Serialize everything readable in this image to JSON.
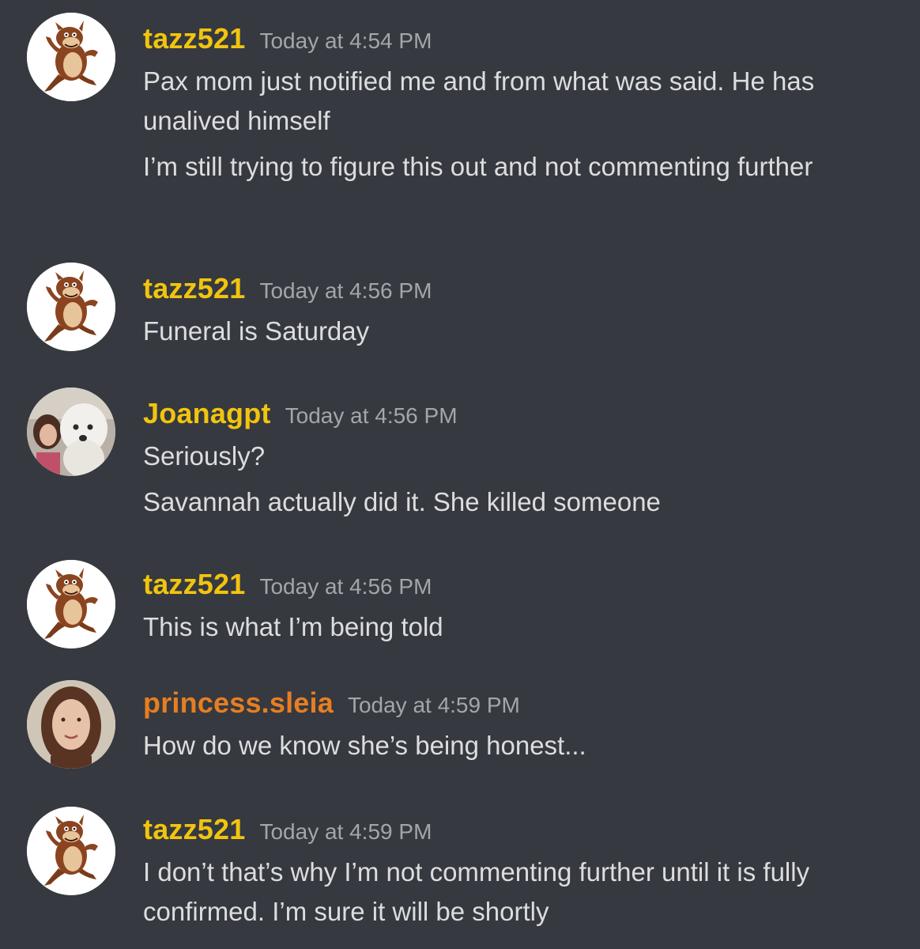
{
  "colors": {
    "background": "#36393f",
    "text": "#dcddde",
    "timestamp": "#a3a6aa",
    "username_yellow": "#f1c40f",
    "username_orange": "#e67e22"
  },
  "messages": [
    {
      "username": "tazz521",
      "timestamp": "Today at 4:54 PM",
      "avatar": "tasmanian-devil-avatar",
      "lines": [
        "Pax mom just notified me and from what was said. He has unalived himself",
        "I’m still trying to figure this out and not commenting further"
      ]
    },
    {
      "username": "tazz521",
      "timestamp": "Today at 4:56 PM",
      "avatar": "tasmanian-devil-avatar",
      "lines": [
        "Funeral is Saturday"
      ]
    },
    {
      "username": "Joanagpt",
      "timestamp": "Today at 4:56 PM",
      "avatar": "woman-with-dog-avatar",
      "lines": [
        "Seriously?",
        "Savannah actually did it. She killed someone"
      ]
    },
    {
      "username": "tazz521",
      "timestamp": "Today at 4:56 PM",
      "avatar": "tasmanian-devil-avatar",
      "lines": [
        "This is what I’m being told"
      ]
    },
    {
      "username": "princess.sleia",
      "timestamp": "Today at 4:59 PM",
      "avatar": "woman-portrait-avatar",
      "lines": [
        "How do we know she’s being honest..."
      ]
    },
    {
      "username": "tazz521",
      "timestamp": "Today at 4:59 PM",
      "avatar": "tasmanian-devil-avatar",
      "lines": [
        "I don’t that’s why I’m not commenting further until it is fully confirmed. I’m sure it will be shortly"
      ]
    }
  ]
}
